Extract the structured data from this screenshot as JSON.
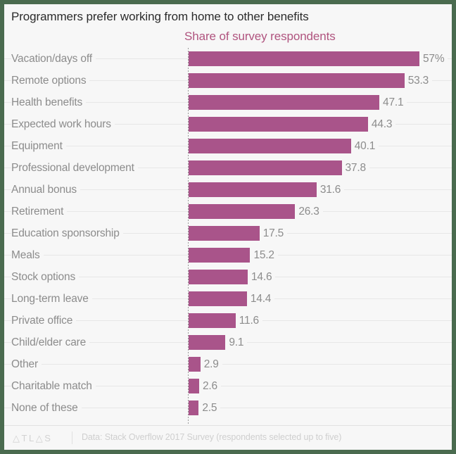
{
  "title": "Programmers prefer working from home to other benefits",
  "subtitle": "Share of survey respondents",
  "footer": {
    "brand": "ATLAS",
    "source": "Data: Stack Overflow 2017 Survey (respondents selected up to five)"
  },
  "colors": {
    "bar": "#a9548a",
    "subtitle": "#b0547f",
    "label": "#8c8c8c",
    "title": "#2b2b2b",
    "background": "#f7f7f7",
    "frame": "#4a6b4f",
    "gridline": "#e7e7e7"
  },
  "chart_data": {
    "type": "bar",
    "orientation": "horizontal",
    "title": "Programmers prefer working from home to other benefits",
    "subtitle": "Share of survey respondents",
    "xlabel": "",
    "ylabel": "",
    "xlim": [
      0,
      57
    ],
    "grid": true,
    "legend": false,
    "unit": "percent",
    "source": "Data: Stack Overflow 2017 Survey (respondents selected up to five)",
    "categories": [
      "Vacation/days off",
      "Remote options",
      "Health benefits",
      "Expected work hours",
      "Equipment",
      "Professional development",
      "Annual bonus",
      "Retirement",
      "Education sponsorship",
      "Meals",
      "Stock options",
      "Long-term leave",
      "Private office",
      "Child/elder care",
      "Other",
      "Charitable match",
      "None of these"
    ],
    "values": [
      57,
      53.3,
      47.1,
      44.3,
      40.1,
      37.8,
      31.6,
      26.3,
      17.5,
      15.2,
      14.6,
      14.4,
      11.6,
      9.1,
      2.9,
      2.6,
      2.5
    ],
    "value_labels": [
      "57%",
      "53.3",
      "47.1",
      "44.3",
      "40.1",
      "37.8",
      "31.6",
      "26.3",
      "17.5",
      "15.2",
      "14.6",
      "14.4",
      "11.6",
      "9.1",
      "2.9",
      "2.6",
      "2.5"
    ]
  }
}
